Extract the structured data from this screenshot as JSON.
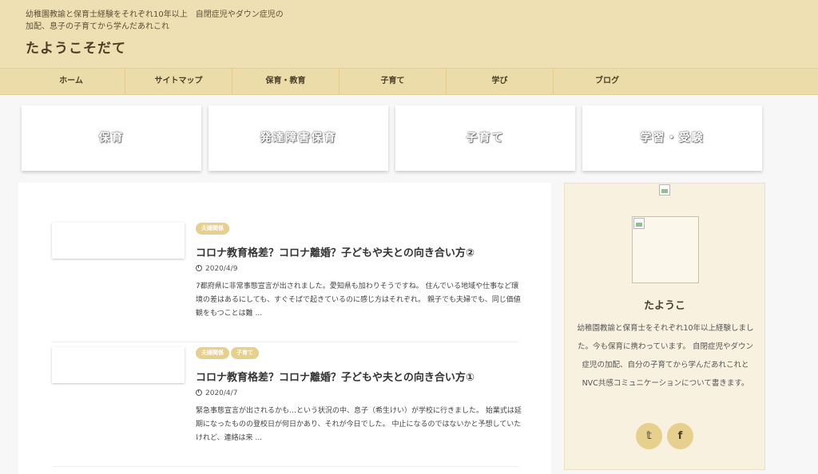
{
  "header": {
    "tagline": "幼稚園教諭と保育士経験をそれぞれ10年以上　自閉症児やダウン症児の加配、息子の子育てから学んだあれこれ",
    "title": "たようこそだて"
  },
  "nav": [
    {
      "label": "ホーム"
    },
    {
      "label": "サイトマップ"
    },
    {
      "label": "保育・教育"
    },
    {
      "label": "子育て"
    },
    {
      "label": "学び"
    },
    {
      "label": "ブログ"
    }
  ],
  "categories": [
    {
      "label": "保育"
    },
    {
      "label": "発達障害保育"
    },
    {
      "label": "子育て"
    },
    {
      "label": "学習・受験"
    }
  ],
  "articles": [
    {
      "tags": [
        "夫婦関係"
      ],
      "title": "コロナ教育格差？コロナ離婚？子どもや夫との向き合い方②",
      "date": "2020/4/9",
      "excerpt": "7都府県に非常事態宣言が出されました。愛知県も加わりそうですね。 住んでいる地域や仕事など環境の差はあるにしても、すぐそばで起きているのに感じ方はそれぞれ。 親子でも夫婦でも、同じ価値観をもつことは難 ..."
    },
    {
      "tags": [
        "夫婦関係",
        "子育て"
      ],
      "title": "コロナ教育格差？コロナ離婚？子どもや夫との向き合い方①",
      "date": "2020/4/7",
      "excerpt": "緊急事態宣言が出されるかも…という状況の中、息子（希生けい）が学校に行きました。 始業式は延期になったものの登校日が何日かあり、それが今日でした。 中止になるのではないかと予想していたけれど、連絡は来 ..."
    }
  ],
  "sidebar": {
    "name": "たようこ",
    "description": "幼稚園教諭と保育士をそれぞれ10年以上経験しました。今も保育に携わっています。 自閉症児やダウン症児の加配、自分の子育てから学んだあれこれとNVC共感コミュニケーションについて書きます。",
    "social": [
      {
        "icon": "twitter-icon",
        "glyph": "𝕥"
      },
      {
        "icon": "facebook-icon",
        "glyph": "f"
      }
    ]
  },
  "colors": {
    "header_bg": "#efe0b3",
    "nav_bg": "#ecdcaa",
    "tag_bg": "#e7cf8e",
    "sidebar_bg": "#f8f1df"
  }
}
